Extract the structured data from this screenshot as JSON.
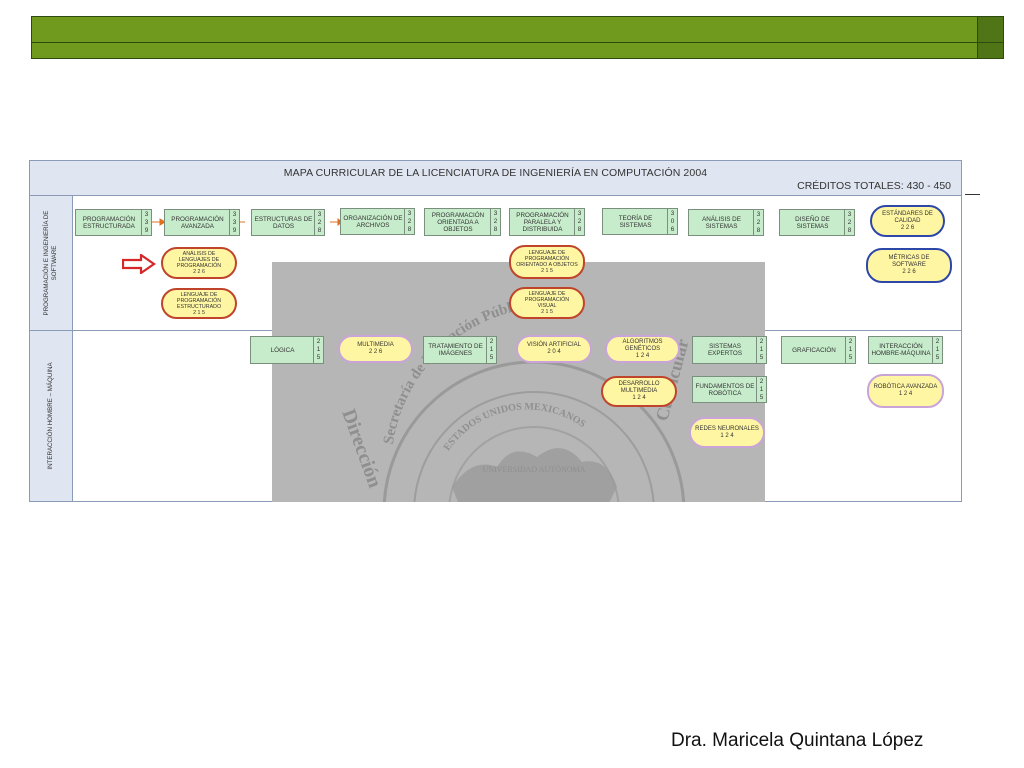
{
  "map": {
    "title": "MAPA CURRICULAR DE LA LICENCIATURA DE INGENIERÍA EN COMPUTACIÓN  2004",
    "credits": "CRÉDITOS TOTALES: 430 - 450"
  },
  "lanes": [
    {
      "label": "PROGRAMACIÓN E INGENIERÍA DE SOFTWARE"
    },
    {
      "label": "INTERACCIÓN HOMBRE – MÁQUINA"
    }
  ],
  "courses": [
    {
      "name": "PROGRAMACIÓN ESTRUCTURADA",
      "credits": [
        "3",
        "3",
        "9"
      ]
    },
    {
      "name": "PROGRAMACIÓN AVANZADA",
      "credits": [
        "3",
        "3",
        "9"
      ]
    },
    {
      "name": "ESTRUCTURAS DE DATOS",
      "credits": [
        "3",
        "2",
        "8"
      ]
    },
    {
      "name": "ORGANIZACIÓN DE ARCHIVOS",
      "credits": [
        "3",
        "2",
        "8"
      ]
    },
    {
      "name": "PROGRAMACIÓN ORIENTADA A OBJETOS",
      "credits": [
        "3",
        "2",
        "8"
      ]
    },
    {
      "name": "PROGRAMACIÓN PARALELA Y DISTRIBUIDA",
      "credits": [
        "3",
        "2",
        "8"
      ]
    },
    {
      "name": "TEORÍA DE SISTEMAS",
      "credits": [
        "3",
        "0",
        "6"
      ]
    },
    {
      "name": "ANÁLISIS DE SISTEMAS",
      "credits": [
        "3",
        "2",
        "8"
      ]
    },
    {
      "name": "DISEÑO DE SISTEMAS",
      "credits": [
        "3",
        "2",
        "8"
      ]
    },
    {
      "name": "LÓGICA",
      "credits": [
        "2",
        "1",
        "5"
      ]
    },
    {
      "name": "TRATAMIENTO DE IMÁGENES",
      "credits": [
        "2",
        "1",
        "5"
      ]
    },
    {
      "name": "SISTEMAS EXPERTOS",
      "credits": [
        "2",
        "1",
        "5"
      ]
    },
    {
      "name": "GRAFICACIÓN",
      "credits": [
        "2",
        "1",
        "5"
      ]
    },
    {
      "name": "INTERACCIÓN HOMBRE-MÁQUINA",
      "credits": [
        "2",
        "1",
        "5"
      ]
    },
    {
      "name": "FUNDAMENTOS DE ROBÓTICA",
      "credits": [
        "2",
        "1",
        "5"
      ]
    }
  ],
  "electives": [
    {
      "name": "ANÁLISIS DE LENGUAJES DE PROGRAMACIÓN",
      "credits": "2 2 6"
    },
    {
      "name": "LENGUAJE DE PROGRAMACIÓN ESTRUCTURADO",
      "credits": "2 1 5"
    },
    {
      "name": "LENGUAJE DE PROGRAMACIÓN ORIENTADO A OBJETOS",
      "credits": "2 1 5"
    },
    {
      "name": "LENGUAJE DE PROGRAMACIÓN VISUAL",
      "credits": "2 1 5"
    },
    {
      "name": "ESTÁNDARES DE CALIDAD",
      "credits": "2 2 6"
    },
    {
      "name": "MÉTRICAS DE SOFTWARE",
      "credits": "2 2 6"
    },
    {
      "name": "MULTIMEDIA",
      "credits": "2 2 6"
    },
    {
      "name": "VISIÓN ARTIFICIAL",
      "credits": "2 0 4"
    },
    {
      "name": "ALGORITMOS GENÉTICOS",
      "credits": "1 2 4"
    },
    {
      "name": "DESARROLLO MULTIMEDIA",
      "credits": "1 2 4"
    },
    {
      "name": "REDES NEURONALES",
      "credits": "1 2 4"
    },
    {
      "name": "ROBÓTICA AVANZADA",
      "credits": "1 2 4"
    }
  ],
  "watermark": {
    "outer": "Secretaría de Educación Pública",
    "left": "Dirección",
    "right": "Curricular",
    "inner": "ESTADOS UNIDOS MEXICANOS",
    "core": "UNIVERSIDAD AUTÓNOMA"
  },
  "footer": {
    "author": "Dra. Maricela Quintana López"
  },
  "colors": {
    "header_green": "#6f9a1e",
    "course_fill": "#c7eccb",
    "elective_fill": "#fff6a3",
    "elective_border": "#c9a4d8",
    "arrow_red": "#d62828",
    "highlight_blue": "#2d47a8"
  }
}
